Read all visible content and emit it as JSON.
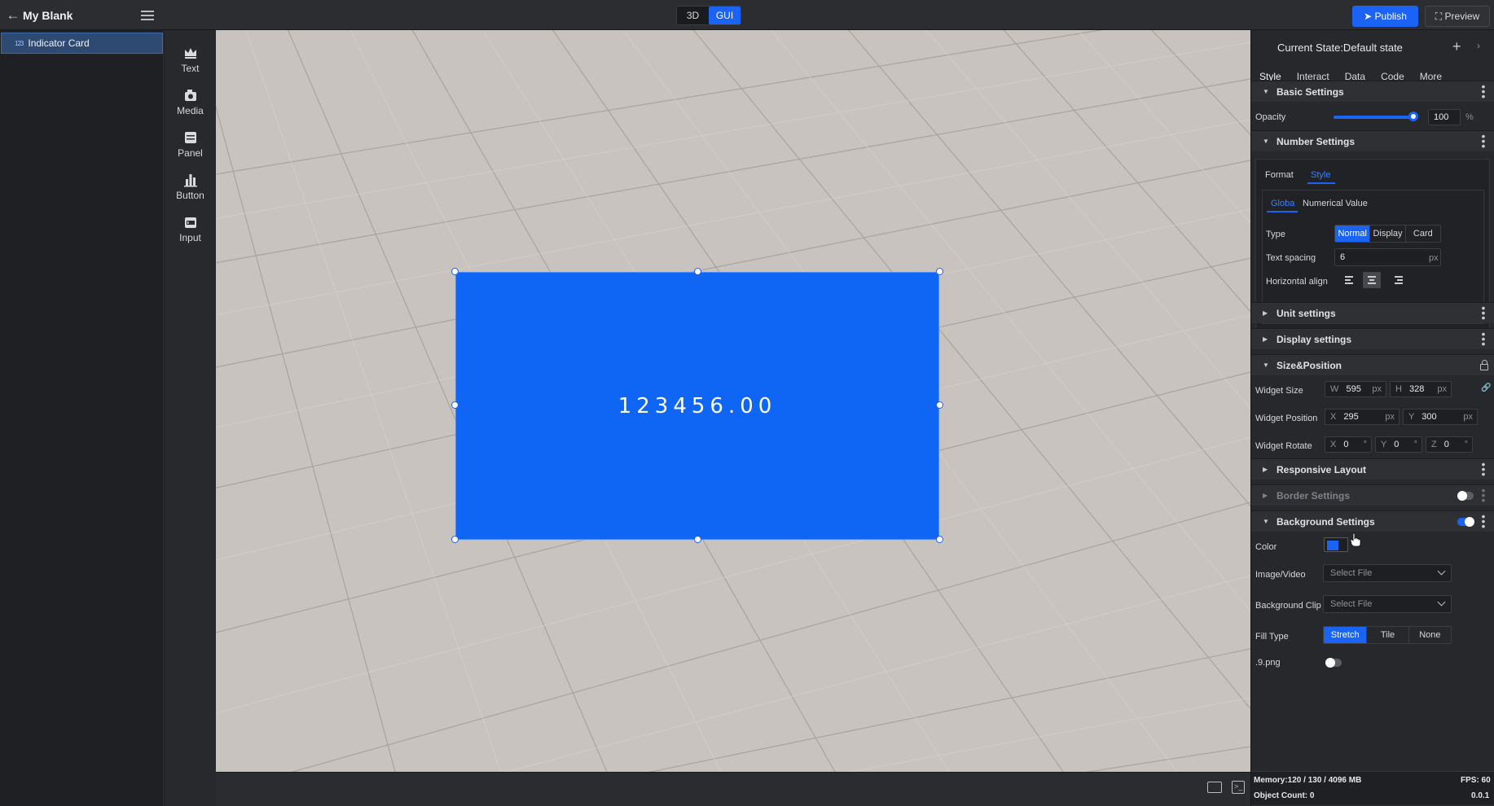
{
  "app": {
    "project_title": "My Blank",
    "mode_toggle": {
      "mode_3d": "3D",
      "mode_gui": "GUI",
      "active": "GUI"
    },
    "publish_label": "Publish",
    "preview_label": "Preview"
  },
  "layers": {
    "items": [
      {
        "icon": "123",
        "label": "Indicator Card",
        "selected": true
      }
    ]
  },
  "tools": [
    {
      "label": "Text",
      "icon": "crown-icon"
    },
    {
      "label": "Media",
      "icon": "media-icon"
    },
    {
      "label": "Panel",
      "icon": "panel-icon"
    },
    {
      "label": "Button",
      "icon": "bar-chart-icon"
    },
    {
      "label": "Input",
      "icon": "input-icon"
    }
  ],
  "canvas": {
    "widget_value": "123456.00",
    "widget_color": "#0f66f5"
  },
  "props": {
    "state_label": "Current State:Default state",
    "tabs": [
      "Style",
      "Interact",
      "Data",
      "Code",
      "More"
    ],
    "active_tab": "Style",
    "basic_settings": {
      "title": "Basic Settings",
      "opacity_label": "Opacity",
      "opacity_value": "100",
      "opacity_unit": "%"
    },
    "number_settings": {
      "title": "Number Settings",
      "subtabs": [
        "Format",
        "Style"
      ],
      "active_subtab": "Style",
      "inner_tabs": [
        "Globa",
        "Numerical Value"
      ],
      "active_inner_tab": "Globa",
      "type_label": "Type",
      "type_options": [
        "Normal",
        "Display",
        "Card"
      ],
      "type_selected": "Normal",
      "text_spacing_label": "Text spacing",
      "text_spacing_value": "6",
      "text_spacing_unit": "px",
      "h_align_label": "Horizontal align",
      "h_align_selected": "center"
    },
    "unit_settings": {
      "title": "Unit settings"
    },
    "display_settings": {
      "title": "Display settings"
    },
    "size_position": {
      "title": "Size&Position",
      "widget_size_label": "Widget Size",
      "w_label": "W",
      "w_value": "595",
      "w_unit": "px",
      "h_label": "H",
      "h_value": "328",
      "h_unit": "px",
      "widget_position_label": "Widget Position",
      "x_label": "X",
      "x_value": "295",
      "x_unit": "px",
      "y_label": "Y",
      "y_value": "300",
      "y_unit": "px",
      "widget_rotate_label": "Widget Rotate",
      "rx_label": "X",
      "rx_value": "0",
      "ry_label": "Y",
      "ry_value": "0",
      "rz_label": "Z",
      "rz_value": "0",
      "deg_unit": "°"
    },
    "responsive_layout": {
      "title": "Responsive Layout"
    },
    "border_settings": {
      "title": "Border Settings",
      "enabled": false
    },
    "background_settings": {
      "title": "Background Settings",
      "enabled": true,
      "color_label": "Color",
      "color_value": "#1a63f5",
      "image_video_label": "Image/Video",
      "image_video_placeholder": "Select File",
      "background_clip_label": "Background Clip",
      "background_clip_placeholder": "Select File",
      "fill_type_label": "Fill Type",
      "fill_type_options": [
        "Stretch",
        "Tile",
        "None"
      ],
      "fill_type_selected": "Stretch",
      "nine_png_label": ".9.png",
      "nine_png_enabled": false
    },
    "footer": {
      "memory": "Memory:120 / 130 / 4096 MB",
      "fps": "FPS: 60",
      "object_count": "Object Count: 0",
      "version": "0.0.1"
    }
  }
}
